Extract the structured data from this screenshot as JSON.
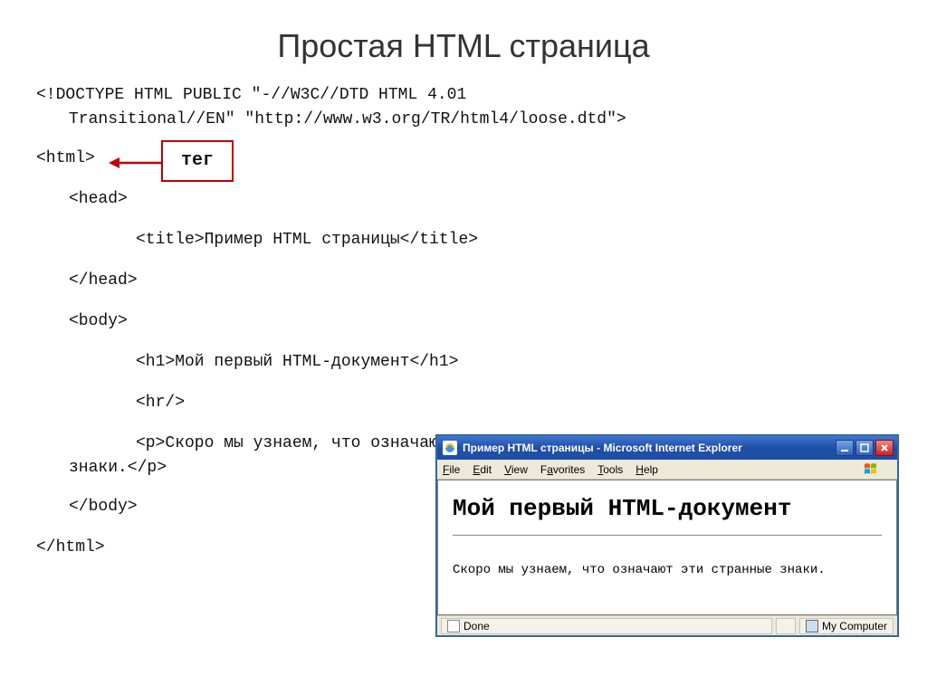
{
  "slide": {
    "title": "Простая HTML страница"
  },
  "code": {
    "doctype_line1": "<!DOCTYPE HTML PUBLIC \"-//W3C//DTD HTML 4.01",
    "doctype_line2": "Transitional//EN\" \"http://www.w3.org/TR/html4/loose.dtd\">",
    "html_open": "<html>",
    "head_open": "<head>",
    "title_line": "<title>Пример HTML страницы</title>",
    "head_close": "</head>",
    "body_open": "<body>",
    "h1_line": "<h1>Мой первый HTML-документ</h1>",
    "hr_line": "<hr/>",
    "p_line1": "<p>Скоро мы узнаем, что означают эти странные",
    "p_line2": "знаки.</p>",
    "body_close": "</body>",
    "html_close": "</html>"
  },
  "callout": {
    "label": "тег"
  },
  "browser": {
    "title": "Пример HTML страницы - Microsoft Internet Explorer",
    "menu": {
      "file": "File",
      "edit": "Edit",
      "view": "View",
      "favorites": "Favorites",
      "tools": "Tools",
      "help": "Help"
    },
    "content": {
      "heading": "Мой первый HTML-документ",
      "paragraph": "Скоро мы узнаем, что означают эти странные знаки."
    },
    "status": {
      "done": "Done",
      "zone": "My Computer"
    }
  }
}
